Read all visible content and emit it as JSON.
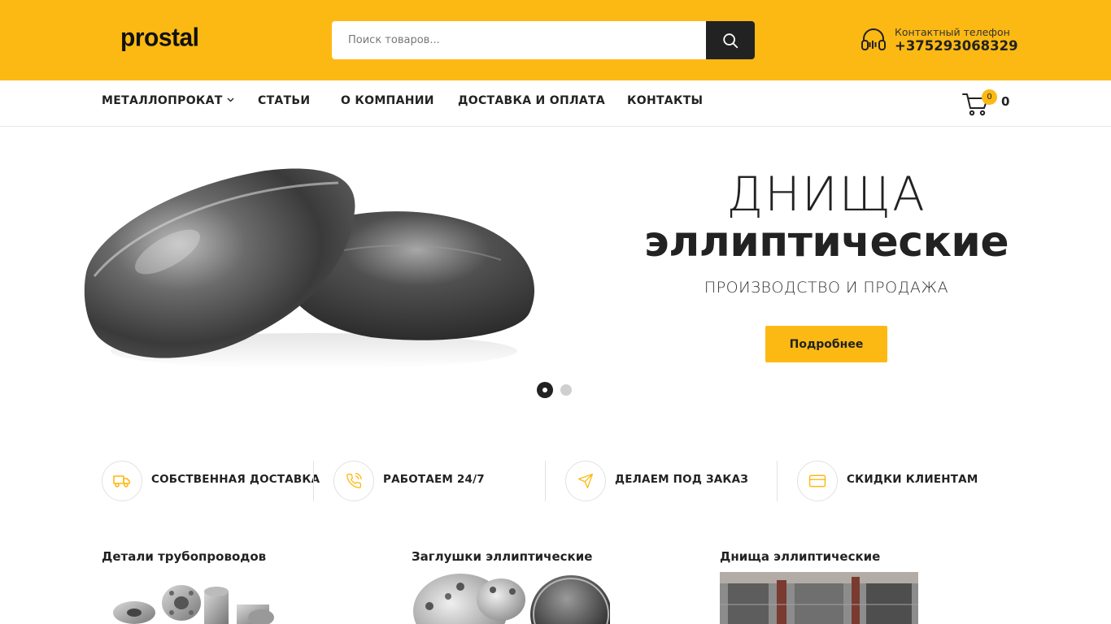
{
  "header": {
    "logo_text": "prostal",
    "search": {
      "placeholder": "Поиск товаров..."
    },
    "contact": {
      "label": "Контактный телефон",
      "phone": "+375293068329"
    },
    "accent_color": "#fdb913"
  },
  "nav": {
    "items": [
      {
        "label": "МЕТАЛЛОПРОКАТ",
        "has_dropdown": true
      },
      {
        "label": "СТАТЬИ"
      },
      {
        "label": "О КОМПАНИИ"
      },
      {
        "label": "ДОСТАВКА И ОПЛАТА"
      },
      {
        "label": "КОНТАКТЫ"
      }
    ],
    "cart": {
      "count": "0",
      "total": "0"
    }
  },
  "hero": {
    "title_line1": "ДНИЩА",
    "title_line2": "эллиптические",
    "subtitle": "ПРОИЗВОДСТВО И ПРОДАЖА",
    "button_label": "Подробнее",
    "slides_total": 2,
    "active_slide": 1
  },
  "features": [
    {
      "icon": "truck-icon",
      "label": "СОБСТВЕННАЯ ДОСТАВКА"
    },
    {
      "icon": "phone-call-icon",
      "label": "РАБОТАЕМ 24/7"
    },
    {
      "icon": "send-icon",
      "label": "ДЕЛАЕМ ПОД ЗАКАЗ"
    },
    {
      "icon": "credit-card-icon",
      "label": "СКИДКИ КЛИЕНТАМ"
    }
  ],
  "categories": [
    {
      "title": "Детали трубопроводов"
    },
    {
      "title": "Заглушки эллиптические"
    },
    {
      "title": "Днища эллиптические"
    }
  ]
}
